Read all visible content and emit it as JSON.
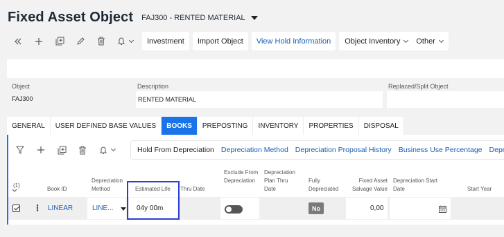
{
  "header": {
    "title": "Fixed Asset Object",
    "record_selector": "FAJ300 - RENTED MATERIAL"
  },
  "toolbar": {
    "icons": [
      "double-chevron-left-icon",
      "plus-icon",
      "duplicate-icon",
      "pencil-icon",
      "trash-icon",
      "bell-icon"
    ],
    "buttons": [
      "Investment",
      "Import Object",
      "View Hold Information"
    ],
    "dropdowns": [
      "Object Inventory",
      "Other"
    ]
  },
  "fields": {
    "object_label": "Object",
    "object_value": "FAJ300",
    "description_label": "Description",
    "description_value": "RENTED MATERIAL",
    "replaced_label": "Replaced/Split Object"
  },
  "tabs": [
    "GENERAL",
    "USER DEFINED BASE VALUES",
    "BOOKS",
    "PREPOSTING",
    "INVENTORY",
    "PROPERTIES",
    "DISPOSAL"
  ],
  "active_tab": "BOOKS",
  "sub_toolbar": {
    "actions": [
      "Hold From Depreciation",
      "Depreciation Method",
      "Depreciation Proposal History",
      "Business Use Percentage",
      "Depre"
    ]
  },
  "table": {
    "selection_count": "(1)",
    "headers": {
      "book_id": "Book ID",
      "depreciation_method": "Depreciation Method",
      "estimated_life": "Estimated Life",
      "thru_date": "Thru Date",
      "exclude": "Exclude From Depreciation",
      "plan_thru": "Depreciation Plan Thru Date",
      "fully_depreciated": "Fully Depreciated",
      "salvage": "Fixed Asset Salvage Value",
      "start_date": "Depreciation Start Date",
      "start_year": "Start Year"
    },
    "row": {
      "book_id": "LINEAR",
      "method": "LINE...",
      "estimated_life": "04y 00m",
      "fully_depreciated": "No",
      "salvage_value": "0,00"
    }
  },
  "colors": {
    "accent": "#1a73e8",
    "link": "#1a5fb4",
    "highlight_box": "#2b3bd6"
  }
}
